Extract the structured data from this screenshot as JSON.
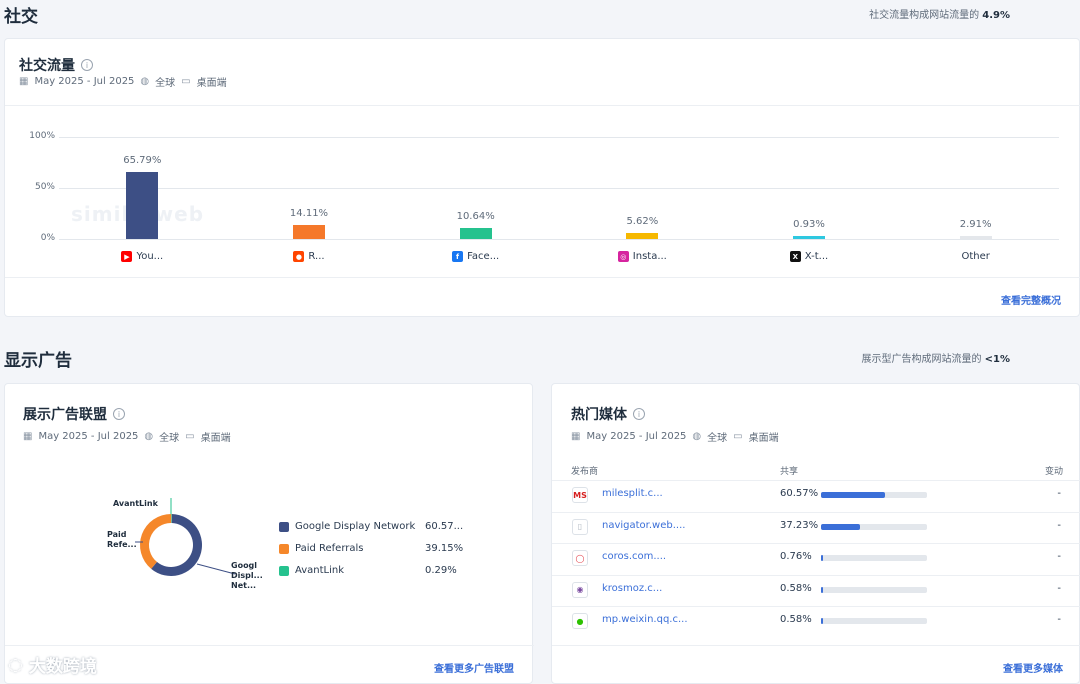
{
  "social": {
    "section_title": "社交",
    "note_prefix": "社交流量构成网站流量的",
    "note_value": "4.9%",
    "card_title": "社交流量",
    "date_range": "May 2025 - Jul 2025",
    "region": "全球",
    "device": "桌面端",
    "watermark": "similarweb",
    "link": "查看完整概况"
  },
  "chart_data": {
    "type": "bar",
    "categories": [
      "You...",
      "R...",
      "Face...",
      "Insta...",
      "X-t...",
      "Other"
    ],
    "values": [
      65.79,
      14.11,
      10.64,
      5.62,
      0.93,
      2.91
    ],
    "value_labels": [
      "65.79%",
      "14.11%",
      "10.64%",
      "5.62%",
      "0.93%",
      "2.91%"
    ],
    "colors": [
      "#3d4f85",
      "#f5782a",
      "#25c28e",
      "#f6b800",
      "#2ec8e0",
      "#e4e7eb"
    ],
    "icons": [
      "youtube-icon",
      "reddit-icon",
      "facebook-icon",
      "instagram-icon",
      "x-icon",
      ""
    ],
    "yticks": [
      "100%",
      "50%",
      "0%"
    ],
    "ylim": [
      0,
      100
    ],
    "grid": true
  },
  "display_ads": {
    "section_title": "显示广告",
    "note_prefix": "展示型广告构成网站流量的",
    "note_value": "<1%"
  },
  "networks": {
    "card_title": "展示广告联盟",
    "date_range": "May 2025 - Jul 2025",
    "region": "全球",
    "device": "桌面端",
    "donut_labels": [
      "AvantLink",
      "Paid\nRefe...",
      "Googl\nDispl...\nNet..."
    ],
    "legend": [
      {
        "name": "Google Display Network",
        "value": "60.57...",
        "share": 60.57,
        "color": "#3d4f85"
      },
      {
        "name": "Paid Referrals",
        "value": "39.15%",
        "share": 39.15,
        "color": "#f5872a"
      },
      {
        "name": "AvantLink",
        "value": "0.29%",
        "share": 0.29,
        "color": "#25c28e"
      }
    ],
    "link": "查看更多广告联盟"
  },
  "media": {
    "card_title": "热门媒体",
    "date_range": "May 2025 - Jul 2025",
    "region": "全球",
    "device": "桌面端",
    "headers": {
      "publisher": "发布商",
      "share": "共享",
      "change": "变动"
    },
    "rows": [
      {
        "site": "milesplit.c...",
        "share": "60.57%",
        "pct": 60.57,
        "change": "-",
        "icon": "milesplit-icon"
      },
      {
        "site": "navigator.web....",
        "share": "37.23%",
        "pct": 37.23,
        "change": "-",
        "icon": "document-icon"
      },
      {
        "site": "coros.com....",
        "share": "0.76%",
        "pct": 0.76,
        "change": "-",
        "icon": "coros-icon"
      },
      {
        "site": "krosmoz.c...",
        "share": "0.58%",
        "pct": 0.58,
        "change": "-",
        "icon": "krosmoz-icon"
      },
      {
        "site": "mp.weixin.qq.c...",
        "share": "0.58%",
        "pct": 0.58,
        "change": "-",
        "icon": "wechat-icon"
      }
    ],
    "link": "查看更多媒体"
  },
  "footer_watermark": "大数跨境"
}
